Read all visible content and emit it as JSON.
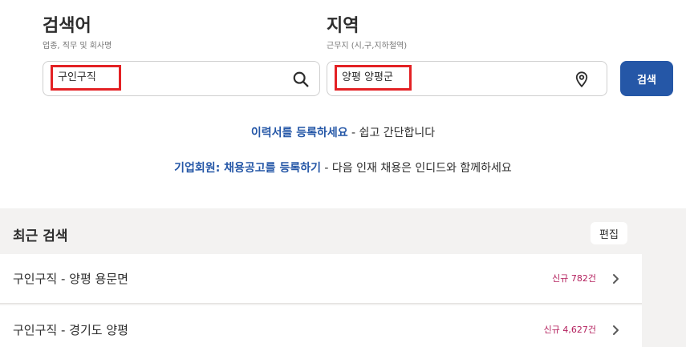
{
  "search": {
    "what": {
      "title": "검색어",
      "subtitle": "업종, 직무 및 회사명",
      "value": "구인구직"
    },
    "where": {
      "title": "지역",
      "subtitle": "근무지 (시,구,지하철역)",
      "value": "양평 양평군"
    },
    "submit_label": "검색"
  },
  "promos": {
    "resume": {
      "link": "이력서를 등록하세요",
      "rest": " - 쉽고 간단합니다"
    },
    "employer": {
      "link": "기업회원: 채용공고를 등록하기",
      "rest": " - 다음 인재 채용은 인디드와 함께하세요"
    }
  },
  "recent": {
    "title": "최근 검색",
    "edit_label": "편집",
    "items": [
      {
        "label": "구인구직 - 양평 용문면",
        "count": "신규 782건"
      },
      {
        "label": "구인구직 - 경기도 양평",
        "count": "신규 4,627건"
      }
    ]
  },
  "colors": {
    "accent": "#2557a7",
    "highlight_border": "#e32124",
    "new_count": "#b31e5c",
    "section_bg": "#f3f2f1"
  },
  "icons": {
    "what": "search-icon",
    "where": "location-pin-icon",
    "item": "chevron-right-icon"
  }
}
